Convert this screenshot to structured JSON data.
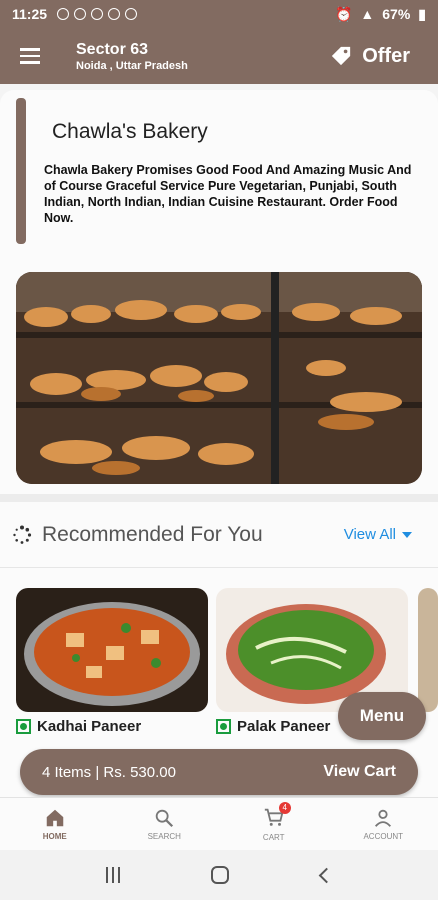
{
  "status_bar": {
    "time": "11:25",
    "battery": "67%"
  },
  "header": {
    "location_title": "Sector 63",
    "location_subtitle": "Noida , Uttar Pradesh",
    "offer_label": "Offer"
  },
  "restaurant": {
    "name": "Chawla's Bakery",
    "description": "Chawla Bakery Promises Good Food And Amazing Music And of Course Graceful Service Pure Vegetarian, Punjabi, South Indian, North Indian, Indian Cuisine Restaurant. Order Food Now."
  },
  "recommended": {
    "title": "Recommended For You",
    "view_all": "View All",
    "items": [
      {
        "name": "Kadhai Paneer"
      },
      {
        "name": "Palak Paneer"
      }
    ]
  },
  "menu_button": "Menu",
  "cart": {
    "summary": "4 Items | Rs. 530.00",
    "view_cart": "View Cart",
    "badge": "4"
  },
  "bottom_nav": {
    "home": "HOME",
    "search": "SEARCH",
    "cart": "CART",
    "account": "ACCOUNT"
  },
  "colors": {
    "brand": "#826b61",
    "link": "#1f8de0",
    "veg": "#1a9c3e"
  }
}
